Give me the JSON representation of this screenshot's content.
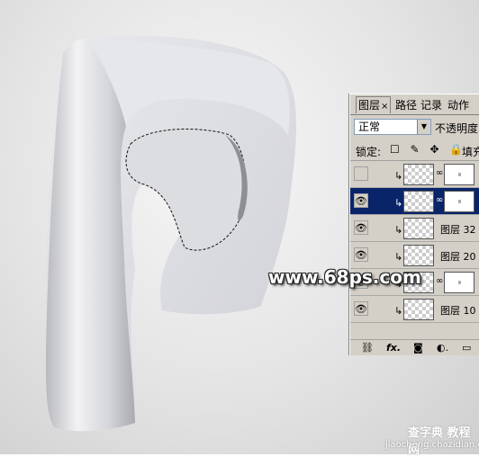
{
  "panel": {
    "tabs": [
      {
        "label": "图层",
        "close": "×"
      },
      {
        "label": "路径"
      },
      {
        "label": "记录"
      },
      {
        "label": "动作"
      }
    ],
    "blend_mode": "正常",
    "opacity_label": "不透明度",
    "lock_label": "锁定:",
    "lock_icons": "☐ ✎ ✥ 🔒",
    "fill_label": "填充",
    "layers": [
      {
        "name": "",
        "visible": false,
        "clipped": true,
        "has_mask": true,
        "selected": false
      },
      {
        "name": "",
        "visible": true,
        "clipped": true,
        "has_mask": true,
        "selected": true
      },
      {
        "name": "图层 32",
        "visible": true,
        "clipped": true,
        "has_mask": false,
        "selected": false
      },
      {
        "name": "图层 20",
        "visible": true,
        "clipped": true,
        "has_mask": false,
        "selected": false
      },
      {
        "name": "",
        "visible": true,
        "clipped": true,
        "has_mask": true,
        "selected": false
      },
      {
        "name": "图层 10",
        "visible": true,
        "clipped": true,
        "has_mask": false,
        "selected": false
      }
    ],
    "bottom_icons": [
      "link-icon",
      "fx-icon",
      "mask-icon",
      "adjustment-icon",
      "folder-icon"
    ],
    "bottom_glyphs": [
      "⛓",
      "fx.",
      "◙",
      "◐.",
      "▭"
    ]
  },
  "watermark": "www.68ps.com",
  "footer": {
    "title": "查字典 教程网",
    "url": "jiaocheng.chazidian.com"
  },
  "colors": {
    "selection_highlight": "#0a246a",
    "panel_bg": "#d4d0c8"
  }
}
